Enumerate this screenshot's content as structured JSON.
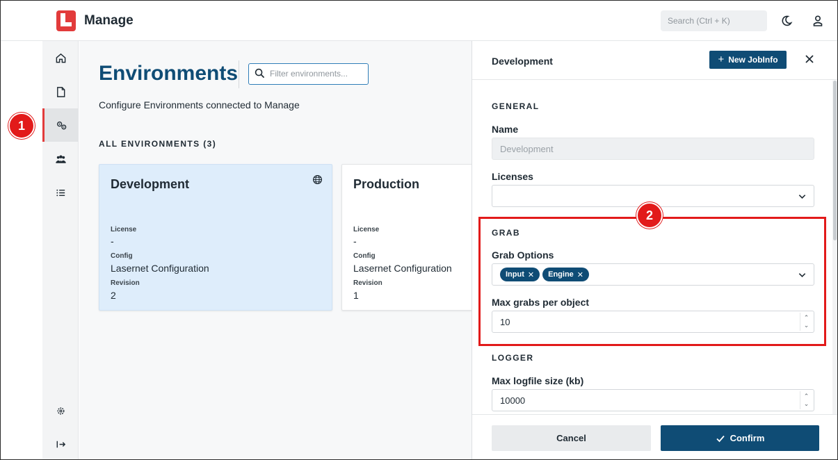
{
  "header": {
    "app_title": "Manage",
    "search_placeholder": "Search (Ctrl + K)",
    "brand_color": "#e23b3b",
    "icons": [
      "logo-icon",
      "moon-icon",
      "user-icon"
    ]
  },
  "sidebar": {
    "items": [
      {
        "name": "home",
        "icon": "home-icon",
        "active": false
      },
      {
        "name": "documents",
        "icon": "document-icon",
        "active": false
      },
      {
        "name": "environments",
        "icon": "gears-icon",
        "active": true
      },
      {
        "name": "users",
        "icon": "users-icon",
        "active": false
      },
      {
        "name": "list",
        "icon": "list-icon",
        "active": false
      }
    ],
    "bottom_items": [
      {
        "name": "settings",
        "icon": "gear-icon"
      },
      {
        "name": "logout",
        "icon": "logout-icon"
      }
    ]
  },
  "markers": {
    "one": "1",
    "two": "2",
    "color": "#e21a1a"
  },
  "main": {
    "title": "Environments",
    "filter_placeholder": "Filter environments...",
    "subtitle": "Configure Environments connected to Manage",
    "section_label": "ALL ENVIRONMENTS (3)",
    "cards": [
      {
        "name": "Development",
        "license_label": "License",
        "license": "-",
        "config_label": "Config",
        "config": "Lasernet Configuration",
        "revision_label": "Revision",
        "revision": "2",
        "selected": true
      },
      {
        "name": "Production",
        "license_label": "License",
        "license": "-",
        "config_label": "Config",
        "config": "Lasernet Configuration",
        "revision_label": "Revision",
        "revision": "1",
        "selected": false
      }
    ]
  },
  "drawer": {
    "title": "Development",
    "new_button": "New JobInfo",
    "general_label": "GENERAL",
    "name_label": "Name",
    "name_value": "Development",
    "licenses_label": "Licenses",
    "licenses_value": "",
    "grab_label": "GRAB",
    "grab_options_label": "Grab Options",
    "grab_options": [
      "Input",
      "Engine"
    ],
    "max_grabs_label": "Max grabs per object",
    "max_grabs_value": "10",
    "logger_label": "LOGGER",
    "max_logfile_label": "Max logfile size (kb)",
    "max_logfile_value": "10000",
    "cancel_button": "Cancel",
    "confirm_button": "Confirm",
    "accent_color": "#0f4c75"
  }
}
